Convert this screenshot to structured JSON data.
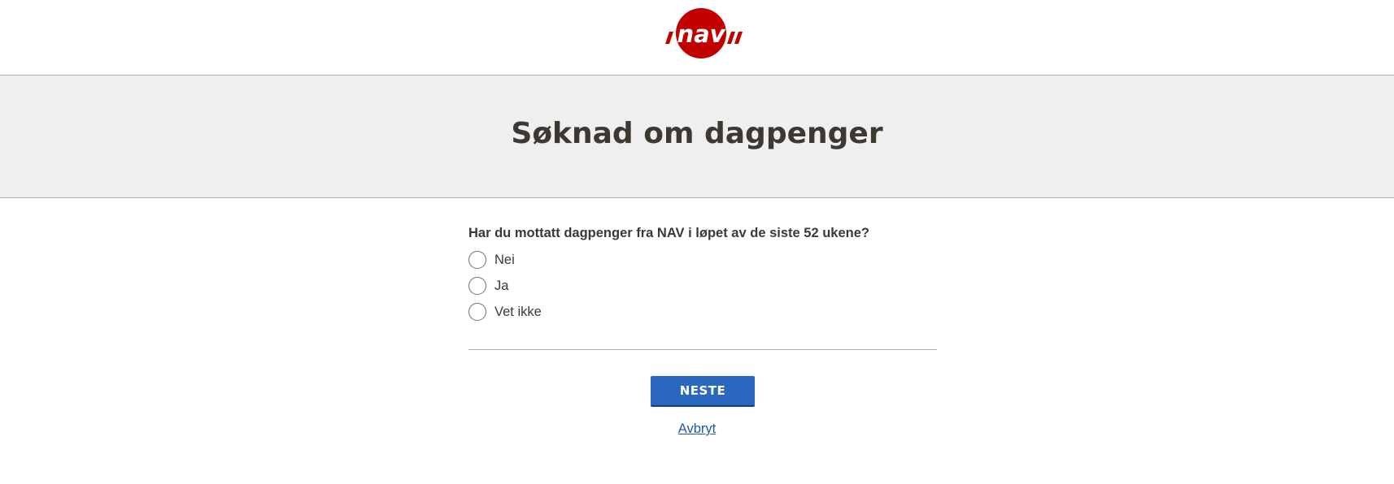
{
  "header": {
    "logo_text": "nav",
    "logo_color": "#c30000"
  },
  "banner": {
    "title": "Søknad om dagpenger"
  },
  "form": {
    "question": "Har du mottatt dagpenger fra NAV i løpet av de siste 52 ukene?",
    "options": [
      {
        "label": "Nei",
        "selected": false
      },
      {
        "label": "Ja",
        "selected": false
      },
      {
        "label": "Vet ikke",
        "selected": false
      }
    ]
  },
  "actions": {
    "next_label": "NESTE",
    "cancel_label": "Avbryt",
    "primary_color": "#2a68c0"
  }
}
